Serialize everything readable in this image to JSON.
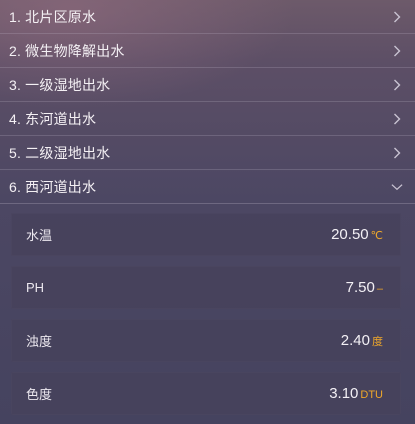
{
  "sections": [
    {
      "label": "1. 北片区原水"
    },
    {
      "label": "2. 微生物降解出水"
    },
    {
      "label": "3. 一级湿地出水"
    },
    {
      "label": "4. 东河道出水"
    },
    {
      "label": "5. 二级湿地出水"
    },
    {
      "label": "6. 西河道出水"
    }
  ],
  "expanded_section_index": 5,
  "metrics": [
    {
      "name": "水温",
      "value": "20.50",
      "unit": "℃"
    },
    {
      "name": "PH",
      "value": "7.50",
      "unit": "–"
    },
    {
      "name": "浊度",
      "value": "2.40",
      "unit": "度"
    },
    {
      "name": "色度",
      "value": "3.10",
      "unit": "DTU"
    }
  ],
  "colors": {
    "unit_accent": "#f0a82a",
    "card_bg": "#46425c",
    "chevron": "#c9c3d2"
  },
  "icons": {
    "collapsed": "chevron-right-icon",
    "expanded": "chevron-down-icon"
  }
}
